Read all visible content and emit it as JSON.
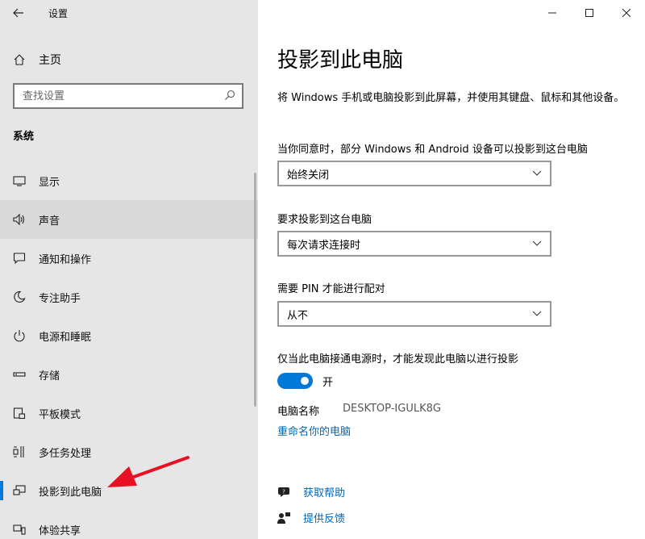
{
  "app": {
    "title": "设置"
  },
  "sidebar": {
    "home_label": "主页",
    "search_placeholder": "查找设置",
    "section_label": "系统",
    "items": [
      {
        "label": "显示",
        "icon": "monitor-icon"
      },
      {
        "label": "声音",
        "icon": "speaker-icon"
      },
      {
        "label": "通知和操作",
        "icon": "notification-icon"
      },
      {
        "label": "专注助手",
        "icon": "moon-icon"
      },
      {
        "label": "电源和睡眠",
        "icon": "power-icon"
      },
      {
        "label": "存储",
        "icon": "storage-icon"
      },
      {
        "label": "平板模式",
        "icon": "tablet-icon"
      },
      {
        "label": "多任务处理",
        "icon": "multitask-icon"
      },
      {
        "label": "投影到此电脑",
        "icon": "project-icon",
        "selected": true
      },
      {
        "label": "体验共享",
        "icon": "share-icon"
      }
    ]
  },
  "main": {
    "title": "投影到此电脑",
    "description": "将 Windows 手机或电脑投影到此屏幕，并使用其键盘、鼠标和其他设备。",
    "settings": [
      {
        "label": "当你同意时，部分 Windows 和 Android 设备可以投影到这台电脑",
        "value": "始终关闭"
      },
      {
        "label": "要求投影到这台电脑",
        "value": "每次请求连接时"
      },
      {
        "label": "需要 PIN 才能进行配对",
        "value": "从不"
      }
    ],
    "power_setting": {
      "label": "仅当此电脑接通电源时，才能发现此电脑以进行投影",
      "toggle_state": "开",
      "on": true
    },
    "pc_name": {
      "label": "电脑名称",
      "value": "DESKTOP-IGULK8G"
    },
    "rename_link": "重命名你的电脑",
    "help": {
      "get_help": "获取帮助",
      "feedback": "提供反馈"
    }
  },
  "colors": {
    "accent": "#0078d7",
    "link": "#0067b8",
    "sidebar_bg": "#e6e6e6",
    "annotation_arrow": "#e81123"
  }
}
